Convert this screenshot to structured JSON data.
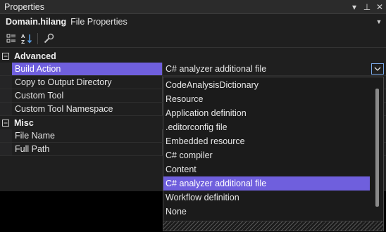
{
  "window": {
    "title": "Properties",
    "dropdown_glyph": "▾",
    "pin_glyph": "⊥",
    "close_glyph": "✕"
  },
  "object_selector": {
    "name": "Domain.hilang",
    "type": "File Properties",
    "arrow_glyph": "▼"
  },
  "toolbar": {
    "tools": [
      "categorized-icon",
      "alphabetical-icon",
      "property-pages-icon"
    ]
  },
  "categories": [
    {
      "label": "Advanced",
      "toggle_glyph": "⊟",
      "properties": [
        {
          "name": "Build Action",
          "value": "C# analyzer additional file"
        },
        {
          "name": "Copy to Output Directory",
          "value": ""
        },
        {
          "name": "Custom Tool",
          "value": ""
        },
        {
          "name": "Custom Tool Namespace",
          "value": ""
        }
      ]
    },
    {
      "label": "Misc",
      "toggle_glyph": "⊟",
      "properties": [
        {
          "name": "File Name",
          "value": ""
        },
        {
          "name": "Full Path",
          "value": ""
        }
      ]
    }
  ],
  "dropdown": {
    "selected": "C# analyzer additional file",
    "options": [
      "CodeAnalysisDictionary",
      "Resource",
      "Application definition",
      ".editorconfig file",
      "Embedded resource",
      "C# compiler",
      "Content",
      "C# analyzer additional file",
      "Workflow definition",
      "None"
    ]
  },
  "colors": {
    "accent": "#6f5fdd",
    "background": "#1f1f1f",
    "combo_border": "#7aa9e8"
  }
}
